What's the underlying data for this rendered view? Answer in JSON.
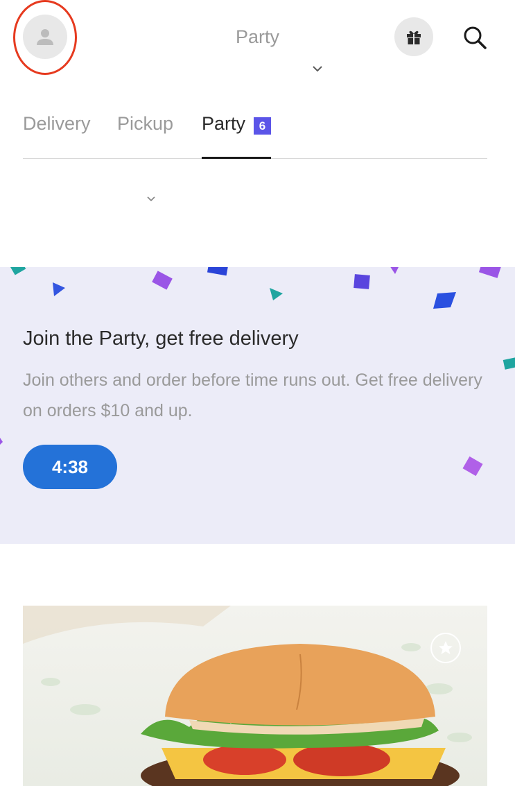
{
  "header": {
    "location_title": "Party",
    "avatar_icon": "user-icon",
    "gift_icon": "gift-icon",
    "search_icon": "search-icon"
  },
  "tabs": [
    {
      "label": "Delivery",
      "active": false
    },
    {
      "label": "Pickup",
      "active": false
    },
    {
      "label": "Party",
      "active": true,
      "badge": "6"
    }
  ],
  "banner": {
    "title": "Join the Party, get free delivery",
    "body": "Join others and order before time runs out. Get free delivery on orders $10 and up.",
    "timer": "4:38"
  },
  "food_card": {
    "favorite_icon": "star-icon"
  },
  "colors": {
    "accent_blue": "#2472d8",
    "badge_purple": "#5b55e8",
    "banner_bg": "#ececf8",
    "highlight_ring": "#e63a1f"
  }
}
